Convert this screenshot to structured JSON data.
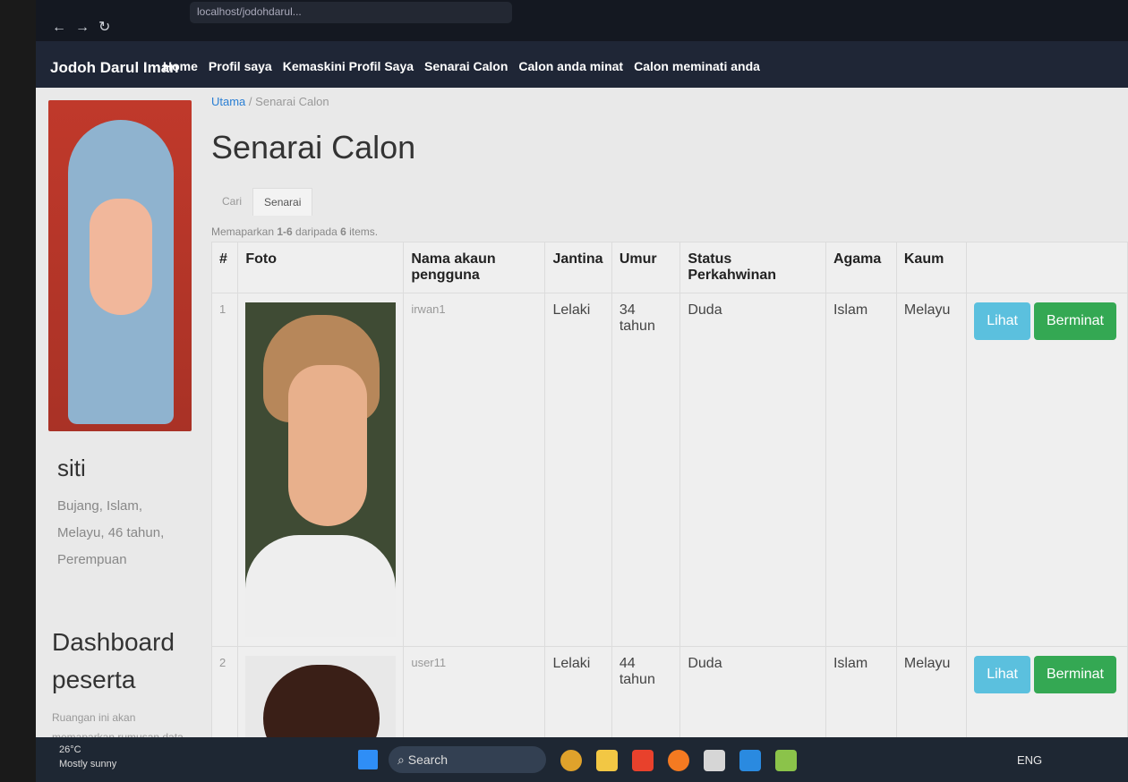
{
  "browser": {
    "url": "localhost/jodohdarul..."
  },
  "navbar": {
    "brand": "Jodoh Darul Iman",
    "links": [
      "Home",
      "Profil saya",
      "Kemaskini Profil Saya",
      "Senarai Calon",
      "Calon anda minat",
      "Calon meminati anda"
    ]
  },
  "sidebar": {
    "name": "siti",
    "info": "Bujang, Islam, Melayu, 46 tahun, Perempuan",
    "dashboard_title": "Dashboard peserta",
    "dashboard_desc": "Ruangan ini akan memaparkan rumusan data-data yang dimiliki oleh peserta ini seperti"
  },
  "main": {
    "breadcrumb": {
      "home": "Utama",
      "separator": "/",
      "current": "Senarai Calon"
    },
    "title": "Senarai Calon",
    "tabs": [
      {
        "label": "Cari",
        "active": false
      },
      {
        "label": "Senarai",
        "active": true
      }
    ],
    "summary_prefix": "Memaparkan ",
    "summary_range": "1-6",
    "summary_mid": " daripada ",
    "summary_total": "6",
    "summary_suffix": " items.",
    "columns": [
      "#",
      "Foto",
      "Nama akaun pengguna",
      "Jantina",
      "Umur",
      "Status Perkahwinan",
      "Agama",
      "Kaum",
      ""
    ],
    "rows": [
      {
        "no": "1",
        "username": "irwan1",
        "gender": "Lelaki",
        "age": "34 tahun",
        "marital": "Duda",
        "religion": "Islam",
        "race": "Melayu",
        "view": "Lihat",
        "action": "Berminat"
      },
      {
        "no": "2",
        "username": "user11",
        "gender": "Lelaki",
        "age": "44 tahun",
        "marital": "Duda",
        "religion": "Islam",
        "race": "Melayu",
        "view": "Lihat",
        "action": "Berminat"
      }
    ]
  },
  "taskbar": {
    "weather_temp": "26°C",
    "weather_desc": "Mostly sunny",
    "search": "Search",
    "lang": "ENG"
  },
  "colors": {
    "navbar": "#1f2636",
    "info_button": "#5bc0de",
    "success_button": "#34a853",
    "link": "#2a7fd4"
  }
}
